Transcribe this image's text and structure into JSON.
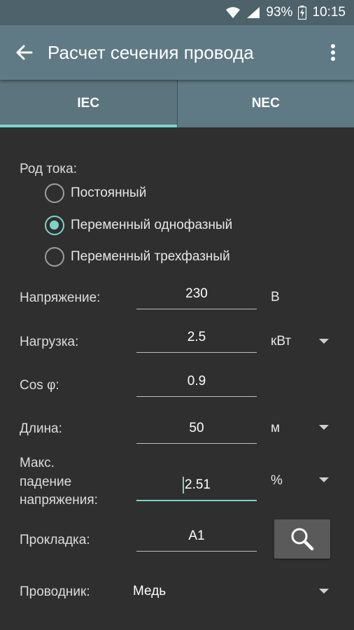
{
  "status_bar": {
    "battery": "93%",
    "time": "10:15"
  },
  "app_bar": {
    "title": "Расчет сечения провода"
  },
  "tabs": [
    {
      "label": "IEC",
      "active": true
    },
    {
      "label": "NEC",
      "active": false
    }
  ],
  "current_type": {
    "label": "Род тока:",
    "options": [
      "Постоянный",
      "Переменный однофазный",
      "Переменный трехфазный"
    ],
    "selected": "Переменный однофазный"
  },
  "voltage": {
    "label": "Напряжение:",
    "value": "230",
    "unit": "В"
  },
  "load": {
    "label": "Нагрузка:",
    "value": "2.5",
    "unit": "кВт"
  },
  "cos_phi": {
    "label": "Cos φ:",
    "value": "0.9"
  },
  "length": {
    "label": "Длина:",
    "value": "50",
    "unit": "м"
  },
  "voltage_drop": {
    "label_lines": [
      "Макс.",
      "падение",
      "напряжения:"
    ],
    "value": "2.51",
    "unit": "%"
  },
  "installation": {
    "label": "Прокладка:",
    "value": "A1"
  },
  "conductor": {
    "label": "Проводник:",
    "value": "Медь"
  },
  "colors": {
    "accent": "#7fd3c8",
    "app_bar": "#5f7a84",
    "status_bar": "#4d626b",
    "background": "#2f2f2f"
  }
}
